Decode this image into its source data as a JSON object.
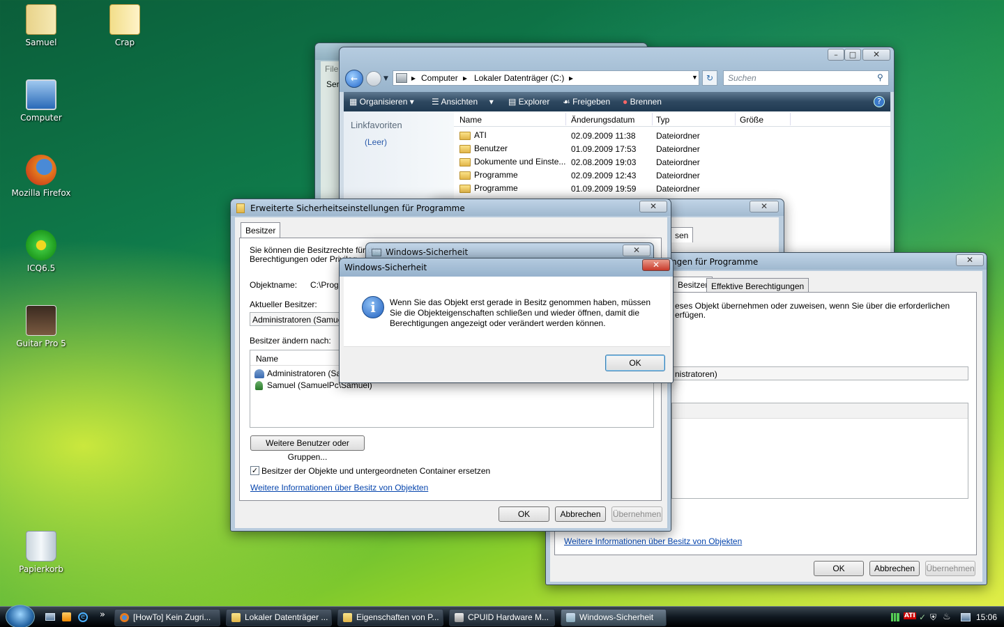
{
  "desktop": {
    "icons": [
      {
        "label": "Samuel",
        "icon": "user-folder-icon"
      },
      {
        "label": "Crap",
        "icon": "folder-icon"
      },
      {
        "label": "Computer",
        "icon": "computer-icon"
      },
      {
        "label": "Mozilla Firefox",
        "icon": "firefox-icon"
      },
      {
        "label": "ICQ6.5",
        "icon": "icq-icon"
      },
      {
        "label": "Guitar Pro 5",
        "icon": "guitar-pro-icon"
      },
      {
        "label": "Papierkorb",
        "icon": "recycle-bin-icon"
      }
    ]
  },
  "bg_window": {
    "menu_item": "File",
    "line2": "Ser"
  },
  "explorer": {
    "address": {
      "crumbs": [
        "Computer",
        "Lokaler Datenträger (C:)"
      ]
    },
    "search_placeholder": "Suchen",
    "toolbar": [
      "Organisieren",
      "Ansichten",
      "Explorer",
      "Freigeben",
      "Brennen"
    ],
    "nav_title": "Linkfavoriten",
    "nav_empty": "(Leer)",
    "columns": [
      "Name",
      "Änderungsdatum",
      "Typ",
      "Größe"
    ],
    "rows": [
      {
        "name": "ATI",
        "date": "02.09.2009 11:38",
        "type": "Dateiordner"
      },
      {
        "name": "Benutzer",
        "date": "01.09.2009 17:53",
        "type": "Dateiordner"
      },
      {
        "name": "Dokumente und Einste...",
        "date": "02.08.2009 19:03",
        "type": "Dateiordner"
      },
      {
        "name": "Programme",
        "date": "02.09.2009 12:43",
        "type": "Dateiordner"
      },
      {
        "name": "Programme",
        "date": "01.09.2009 19:59",
        "type": "Dateiordner"
      }
    ]
  },
  "adv_back": {
    "title_fragment": "ngen für Programme",
    "tabs": [
      "Besitzer",
      "Effektive Berechtigungen"
    ],
    "text_line1": "eses Objekt übernehmen oder zuweisen, wenn Sie über die erforderlichen",
    "text_line2": "erfügen.",
    "owner_fragment": "nistratoren)",
    "link": "Weitere Informationen über Besitz von Objekten",
    "buttons": {
      "ok": "OK",
      "cancel": "Abbrechen",
      "apply": "Übernehmen"
    }
  },
  "mid_window": {
    "tab_fragment": "sen"
  },
  "adv_front": {
    "title": "Erweiterte Sicherheitseinstellungen für Programme",
    "tab": "Besitzer",
    "intro_line1": "Sie können die Besitzrechte für dies",
    "intro_line2": "Berechtigungen oder Privileg",
    "object_label": "Objektname:",
    "object_value": "C:\\Progr",
    "current_owner_label": "Aktueller Besitzer:",
    "current_owner_value": "Administratoren (SamuelPc",
    "change_owner_label": "Besitzer ändern nach:",
    "list_header": "Name",
    "list_items": [
      "Administratoren (Samu",
      "Samuel (SamuelPc\\Samuel)"
    ],
    "other_users_button": "Weitere Benutzer oder Gruppen...",
    "replace_checkbox": "Besitzer der Objekte und untergeordneten Container ersetzen",
    "replace_checked": true,
    "link": "Weitere Informationen über Besitz von Objekten",
    "buttons": {
      "ok": "OK",
      "cancel": "Abbrechen",
      "apply": "Übernehmen"
    }
  },
  "security_back": {
    "title": "Windows-Sicherheit"
  },
  "dialog": {
    "title": "Windows-Sicherheit",
    "message_lines": [
      "Wenn Sie das Objekt erst gerade in Besitz genommen haben, müssen",
      "Sie die Objekteigenschaften schließen und wieder öffnen, damit die",
      "Berechtigungen angezeigt oder verändert werden können."
    ],
    "ok": "OK"
  },
  "taskbar": {
    "tasks": [
      "[HowTo] Kein Zugri...",
      "Lokaler Datenträger ...",
      "Eigenschaften von P...",
      "CPUID Hardware M...",
      "Windows-Sicherheit"
    ],
    "chevron": "»",
    "clock": "15:06",
    "tray_ati": "ATI"
  },
  "colors": {
    "accent": "#3c7fb1",
    "link": "#0645ad",
    "dialog_info": "#1f5fbf"
  }
}
